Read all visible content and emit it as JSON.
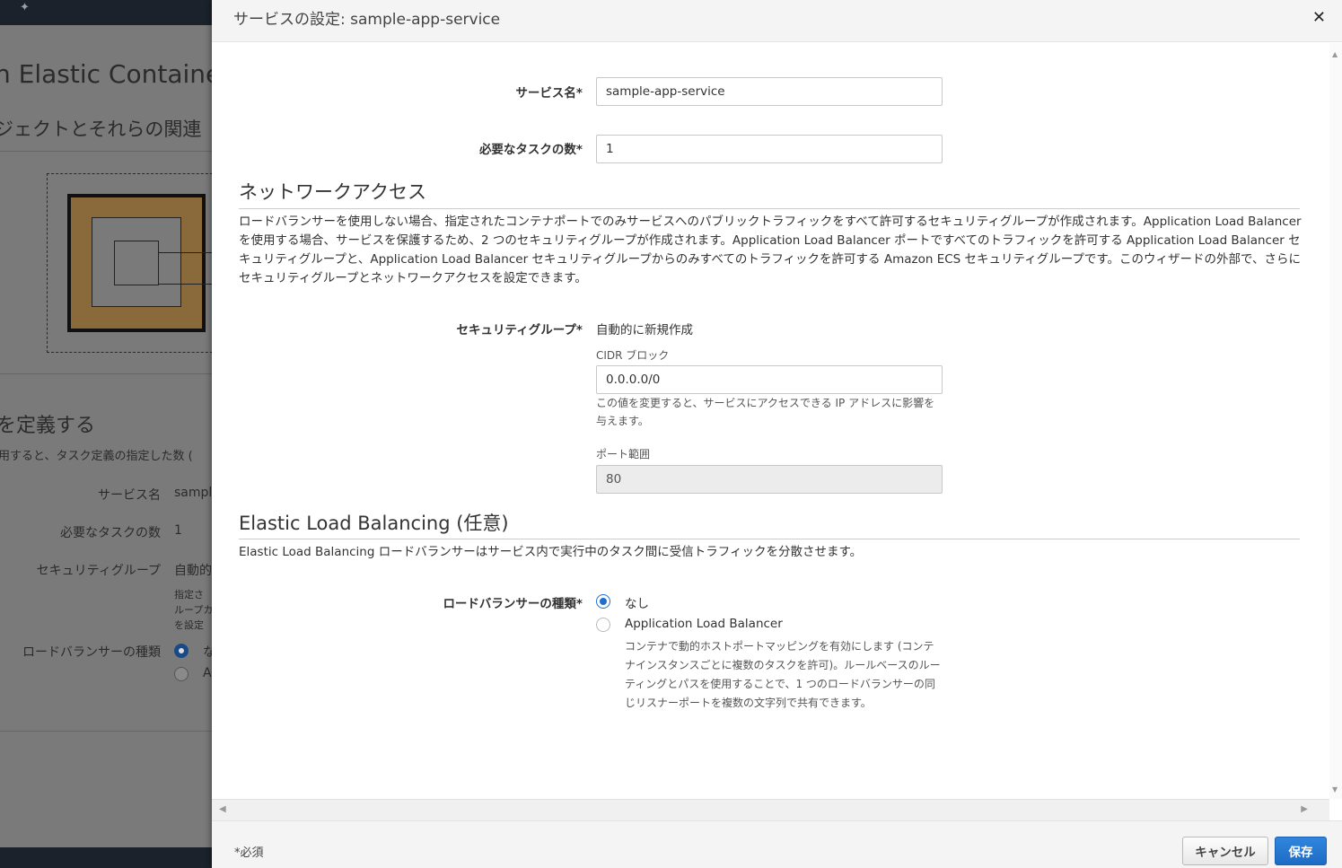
{
  "background": {
    "title": "n Elastic Container",
    "subtitle": "ジェクトとそれらの関連",
    "section_title": "を定義する",
    "section_desc": "用すると、タスク定義の指定した数 (",
    "rows": [
      {
        "label": "サービス名",
        "value": "sample"
      },
      {
        "label": "必要なタスクの数",
        "value": "1"
      },
      {
        "label": "セキュリティグループ",
        "value": "自動的"
      }
    ],
    "sg_help": [
      "指定さ",
      "ループカ",
      "を設定"
    ],
    "lb_label": "ロードバランサーの種類",
    "lb_opt1": "な",
    "lb_opt2": "A"
  },
  "modal": {
    "title": "サービスの設定: sample-app-service",
    "close_icon": "close-icon",
    "service_name": {
      "label": "サービス名*",
      "value": "sample-app-service"
    },
    "task_count": {
      "label": "必要なタスクの数*",
      "value": "1"
    },
    "network": {
      "title": "ネットワークアクセス",
      "description": "ロードバランサーを使用しない場合、指定されたコンテナポートでのみサービスへのパブリックトラフィックをすべて許可するセキュリティグループが作成されます。Application Load Balancer を使用する場合、サービスを保護するため、2 つのセキュリティグループが作成されます。Application Load Balancer ポートですべてのトラフィックを許可する Application Load Balancer セキュリティグループと、Application Load Balancer セキュリティグループからのみすべてのトラフィックを許可する Amazon ECS セキュリティグループです。このウィザードの外部で、さらにセキュリティグループとネットワークアクセスを設定できます。",
      "security_group": {
        "label": "セキュリティグループ*",
        "value": "自動的に新規作成"
      },
      "cidr": {
        "label": "CIDR ブロック",
        "value": "0.0.0.0/0",
        "help": "この値を変更すると、サービスにアクセスできる IP アドレスに影響を与えます。"
      },
      "port": {
        "label": "ポート範囲",
        "value": "80"
      }
    },
    "elb": {
      "title": "Elastic Load Balancing (任意)",
      "description": "Elastic Load Balancing ロードバランサーはサービス内で実行中のタスク間に受信トラフィックを分散させます。",
      "lb_type": {
        "label": "ロードバランサーの種類*",
        "options": [
          {
            "label": "なし",
            "checked": true
          },
          {
            "label": "Application Load Balancer",
            "checked": false,
            "help": "コンテナで動的ホストポートマッピングを有効にします (コンテナインスタンスごとに複数のタスクを許可)。ルールベースのルーティングとパスを使用することで、1 つのロードバランサーの同じリスナーポートを複数の文字列で共有できます。"
          }
        ]
      }
    },
    "footer": {
      "required_note": "*必須",
      "cancel_label": "キャンセル",
      "save_label": "保存"
    }
  }
}
